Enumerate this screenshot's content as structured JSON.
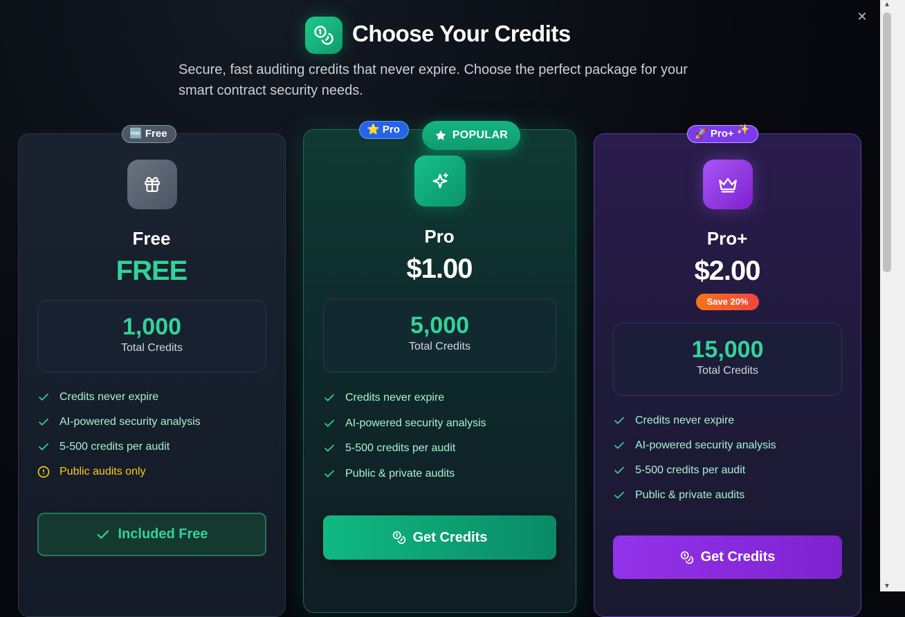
{
  "header": {
    "title": "Choose Your Credits",
    "subtitle": "Secure, fast auditing credits that never expire. Choose the perfect package for your smart contract security needs.",
    "close_icon": "close-icon",
    "title_icon": "coins-icon"
  },
  "plans": [
    {
      "badge": "Free",
      "badge_emoji": "🆓",
      "name": "Free",
      "price": "FREE",
      "credits": "1,000",
      "credits_label": "Total Credits",
      "features": [
        "Credits never expire",
        "AI-powered security analysis",
        "5-500 credits per audit",
        "Public audits only"
      ],
      "button": "Included Free",
      "icon": "gift-icon"
    },
    {
      "badge": "Pro",
      "badge_emoji": "⭐",
      "popular": "POPULAR",
      "name": "Pro",
      "price": "$1.00",
      "credits": "5,000",
      "credits_label": "Total Credits",
      "features": [
        "Credits never expire",
        "AI-powered security analysis",
        "5-500 credits per audit",
        "Public & private audits"
      ],
      "button": "Get Credits",
      "icon": "sparkles-icon"
    },
    {
      "badge": "Pro+",
      "badge_emoji": "🚀",
      "badge_extra": "✨",
      "name": "Pro+",
      "price": "$2.00",
      "save": "Save 20%",
      "credits": "15,000",
      "credits_label": "Total Credits",
      "features": [
        "Credits never expire",
        "AI-powered security analysis",
        "5-500 credits per audit",
        "Public & private audits"
      ],
      "button": "Get Credits",
      "icon": "crown-icon"
    }
  ],
  "colors": {
    "accent_green": "#34d399",
    "pro_purple": "#9333ea",
    "warning": "#facc15"
  }
}
